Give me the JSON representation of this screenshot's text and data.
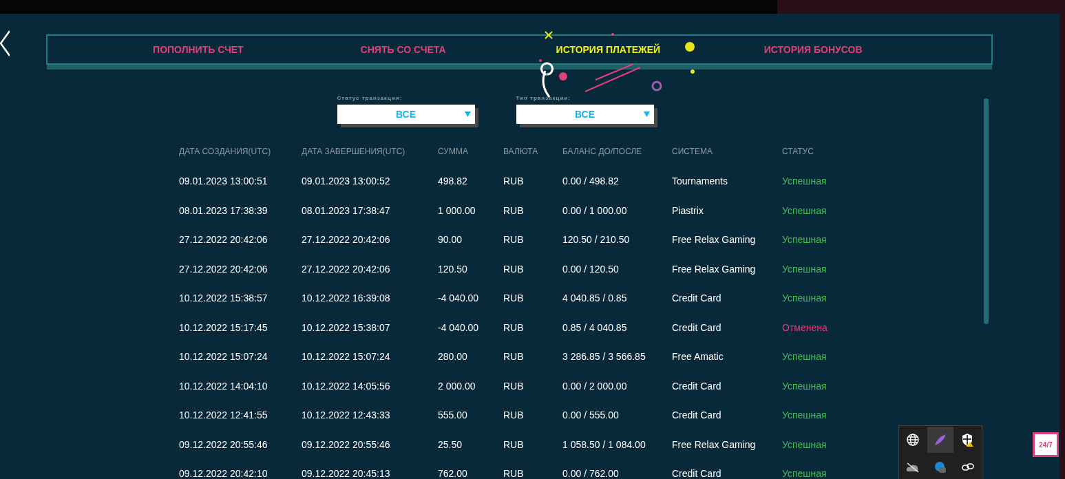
{
  "tabs": [
    {
      "label": "ПОПОЛНИТЬ СЧЕТ",
      "selected": false
    },
    {
      "label": "СНЯТЬ СО СЧЕТА",
      "selected": false
    },
    {
      "label": "ИСТОРИЯ ПЛАТЕЖЕЙ",
      "selected": true
    },
    {
      "label": "ИСТОРИЯ БОНУСОВ",
      "selected": false
    }
  ],
  "filters": [
    {
      "label": "Статус транзакции:",
      "value": "ВСЕ"
    },
    {
      "label": "Тип транзакции:",
      "value": "ВСЕ"
    }
  ],
  "table": {
    "columns": [
      "ДАТА СОЗДАНИЯ(UTC)",
      "ДАТА ЗАВЕРШЕНИЯ(UTC)",
      "СУММА",
      "ВАЛЮТА",
      "БАЛАНС ДО/ПОСЛЕ",
      "СИСТЕМА",
      "СТАТУС"
    ],
    "rows": [
      {
        "cells": [
          "09.01.2023 13:00:51",
          "09.01.2023 13:00:52",
          "498.82",
          "RUB",
          "0.00 / 498.82",
          "Tournaments",
          "Успешная"
        ],
        "color": "#3fbf4f"
      },
      {
        "cells": [
          "08.01.2023 17:38:39",
          "08.01.2023 17:38:47",
          "1 000.00",
          "RUB",
          "0.00 / 1 000.00",
          "Piastrix",
          "Успешная"
        ],
        "color": "#3fbf4f"
      },
      {
        "cells": [
          "27.12.2022 20:42:06",
          "27.12.2022 20:42:06",
          "90.00",
          "RUB",
          "120.50 / 210.50",
          "Free Relax Gaming",
          "Успешная"
        ],
        "color": "#3fbf4f"
      },
      {
        "cells": [
          "27.12.2022 20:42:06",
          "27.12.2022 20:42:06",
          "120.50",
          "RUB",
          "0.00 / 120.50",
          "Free Relax Gaming",
          "Успешная"
        ],
        "color": "#3fbf4f"
      },
      {
        "cells": [
          "10.12.2022 15:38:57",
          "10.12.2022 16:39:08",
          "-4 040.00",
          "RUB",
          "4 040.85 / 0.85",
          "Credit Card",
          "Успешная"
        ],
        "color": "#3fbf4f"
      },
      {
        "cells": [
          "10.12.2022 15:17:45",
          "10.12.2022 15:38:07",
          "-4 040.00",
          "RUB",
          "0.85 / 4 040.85",
          "Credit Card",
          "Отменена"
        ],
        "color": "#e0407a"
      },
      {
        "cells": [
          "10.12.2022 15:07:24",
          "10.12.2022 15:07:24",
          "280.00",
          "RUB",
          "3 286.85 / 3 566.85",
          "Free Amatic",
          "Успешная"
        ],
        "color": "#3fbf4f"
      },
      {
        "cells": [
          "10.12.2022 14:04:10",
          "10.12.2022 14:05:56",
          "2 000.00",
          "RUB",
          "0.00 / 2 000.00",
          "Credit Card",
          "Успешная"
        ],
        "color": "#3fbf4f"
      },
      {
        "cells": [
          "10.12.2022 12:41:55",
          "10.12.2022 12:43:33",
          "555.00",
          "RUB",
          "0.00 / 555.00",
          "Credit Card",
          "Успешная"
        ],
        "color": "#3fbf4f"
      },
      {
        "cells": [
          "09.12.2022 20:55:46",
          "09.12.2022 20:55:46",
          "25.50",
          "RUB",
          "1 058.50 / 1 084.00",
          "Free Relax Gaming",
          "Успешная"
        ],
        "color": "#3fbf4f"
      },
      {
        "cells": [
          "09.12.2022 20:42:10",
          "09.12.2022 20:45:13",
          "762.00",
          "RUB",
          "0.00 / 762.00",
          "Credit Card",
          "Успешная"
        ],
        "color": "#3fbf4f"
      }
    ]
  },
  "chat_button": "24/7"
}
